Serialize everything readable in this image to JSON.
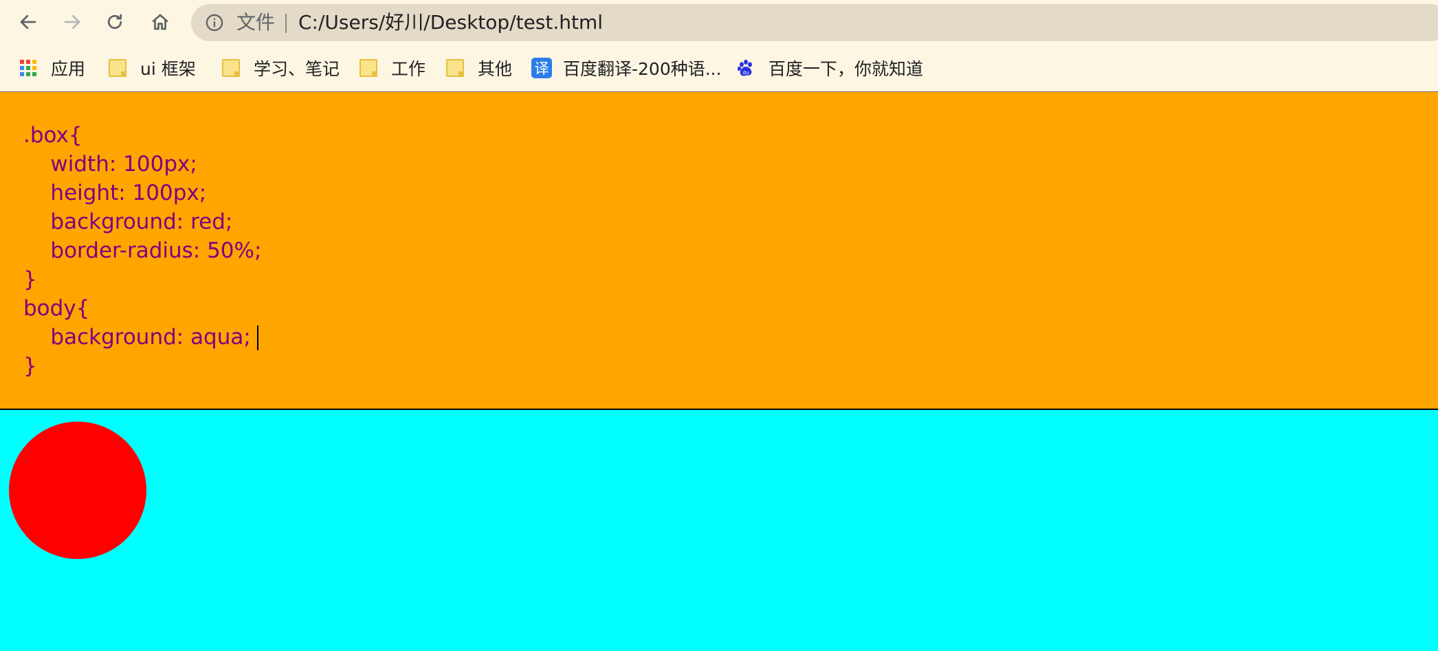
{
  "browser": {
    "omnibox": {
      "scheme_label": "文件",
      "url": "C:/Users/好川/Desktop/test.html"
    },
    "bookmarks": [
      {
        "label": "应用",
        "icon": "apps-grid-icon"
      },
      {
        "label": "ui  框架",
        "icon": "folder-icon"
      },
      {
        "label": "学习、笔记",
        "icon": "folder-icon"
      },
      {
        "label": "工作",
        "icon": "folder-icon"
      },
      {
        "label": "其他",
        "icon": "folder-icon"
      },
      {
        "label": "百度翻译-200种语...",
        "icon": "translate-icon",
        "icon_text": "译"
      },
      {
        "label": "百度一下，你就知道",
        "icon": "baidu-paw-icon"
      }
    ]
  },
  "page": {
    "background": "#00ffff",
    "style_block": {
      "background": "#ffa500",
      "text_color": "#800080",
      "lines": [
        ".box{",
        "    width: 100px;",
        "    height: 100px;",
        "    background: red;",
        "    border-radius: 50%;",
        "}",
        "body{",
        "    background: aqua; ",
        "}"
      ]
    },
    "box": {
      "color": "#ff0000",
      "shape": "circle"
    }
  }
}
